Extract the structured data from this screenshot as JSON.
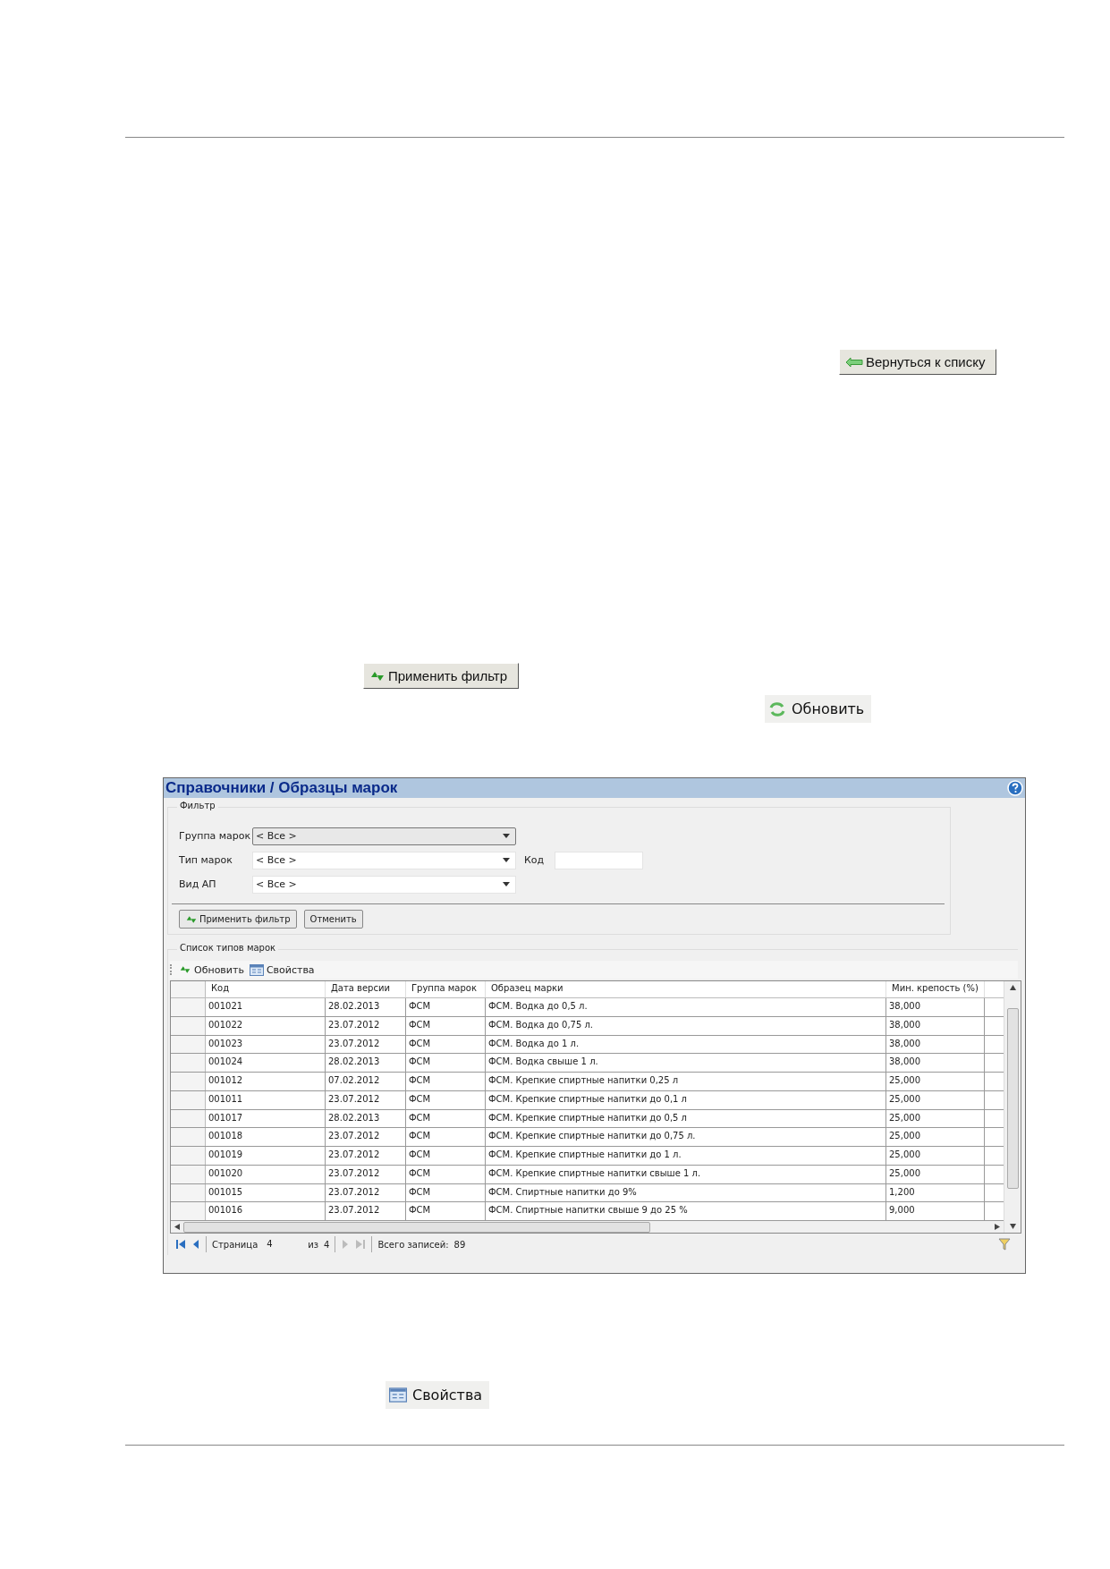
{
  "doc_buttons": {
    "back": "Вернуться к списку",
    "apply": "Применить фильтр",
    "refresh": "Обновить",
    "properties": "Свойства"
  },
  "app": {
    "title": "Справочники / Образцы марок",
    "filter": {
      "legend": "Фильтр",
      "fields": [
        {
          "kind": "combo",
          "label": "Группа марок",
          "value": "< Все >",
          "selected": true
        },
        {
          "kind": "combo",
          "label": "Тип марок",
          "value": "< Все >",
          "selected": false
        },
        {
          "kind": "combo",
          "label": "Вид АП",
          "value": "< Все >",
          "selected": false
        }
      ],
      "code": {
        "label": "Код"
      },
      "buttons": [
        "Применить фильтр",
        "Отменить"
      ]
    },
    "list": {
      "legend": "Список типов марок",
      "toolbar": [
        "Обновить",
        "Свойства"
      ],
      "columns": [
        "Код",
        "Дата версии",
        "Группа марок",
        "Образец марки",
        "Мин. крепость (%)"
      ],
      "rows": [
        [
          "001021",
          "28.02.2013",
          "ФСМ",
          "ФСМ. Водка до 0,5 л.",
          "38,000"
        ],
        [
          "001022",
          "23.07.2012",
          "ФСМ",
          "ФСМ. Водка до 0,75 л.",
          "38,000"
        ],
        [
          "001023",
          "23.07.2012",
          "ФСМ",
          "ФСМ. Водка до 1 л.",
          "38,000"
        ],
        [
          "001024",
          "28.02.2013",
          "ФСМ",
          "ФСМ. Водка свыше 1 л.",
          "38,000"
        ],
        [
          "001012",
          "07.02.2012",
          "ФСМ",
          "ФСМ. Крепкие спиртные напитки 0,25 л",
          "25,000"
        ],
        [
          "001011",
          "23.07.2012",
          "ФСМ",
          "ФСМ. Крепкие спиртные напитки до 0,1 л",
          "25,000"
        ],
        [
          "001017",
          "28.02.2013",
          "ФСМ",
          "ФСМ. Крепкие спиртные напитки до 0,5 л",
          "25,000"
        ],
        [
          "001018",
          "23.07.2012",
          "ФСМ",
          "ФСМ. Крепкие спиртные напитки до 0,75 л.",
          "25,000"
        ],
        [
          "001019",
          "23.07.2012",
          "ФСМ",
          "ФСМ. Крепкие спиртные напитки до 1 л.",
          "25,000"
        ],
        [
          "001020",
          "23.07.2012",
          "ФСМ",
          "ФСМ. Крепкие спиртные напитки свыше 1 л.",
          "25,000"
        ],
        [
          "001015",
          "23.07.2012",
          "ФСМ",
          "ФСМ. Спиртные напитки до 9%",
          "1,200"
        ],
        [
          "001016",
          "23.07.2012",
          "ФСМ",
          "ФСМ. Спиртные напитки свыше 9 до 25 %",
          "9,000"
        ]
      ],
      "pager": {
        "page_label": "Страница",
        "page": "4",
        "of_label": "из",
        "of": "4",
        "total_label": "Всего записей:",
        "total": "89"
      }
    }
  }
}
